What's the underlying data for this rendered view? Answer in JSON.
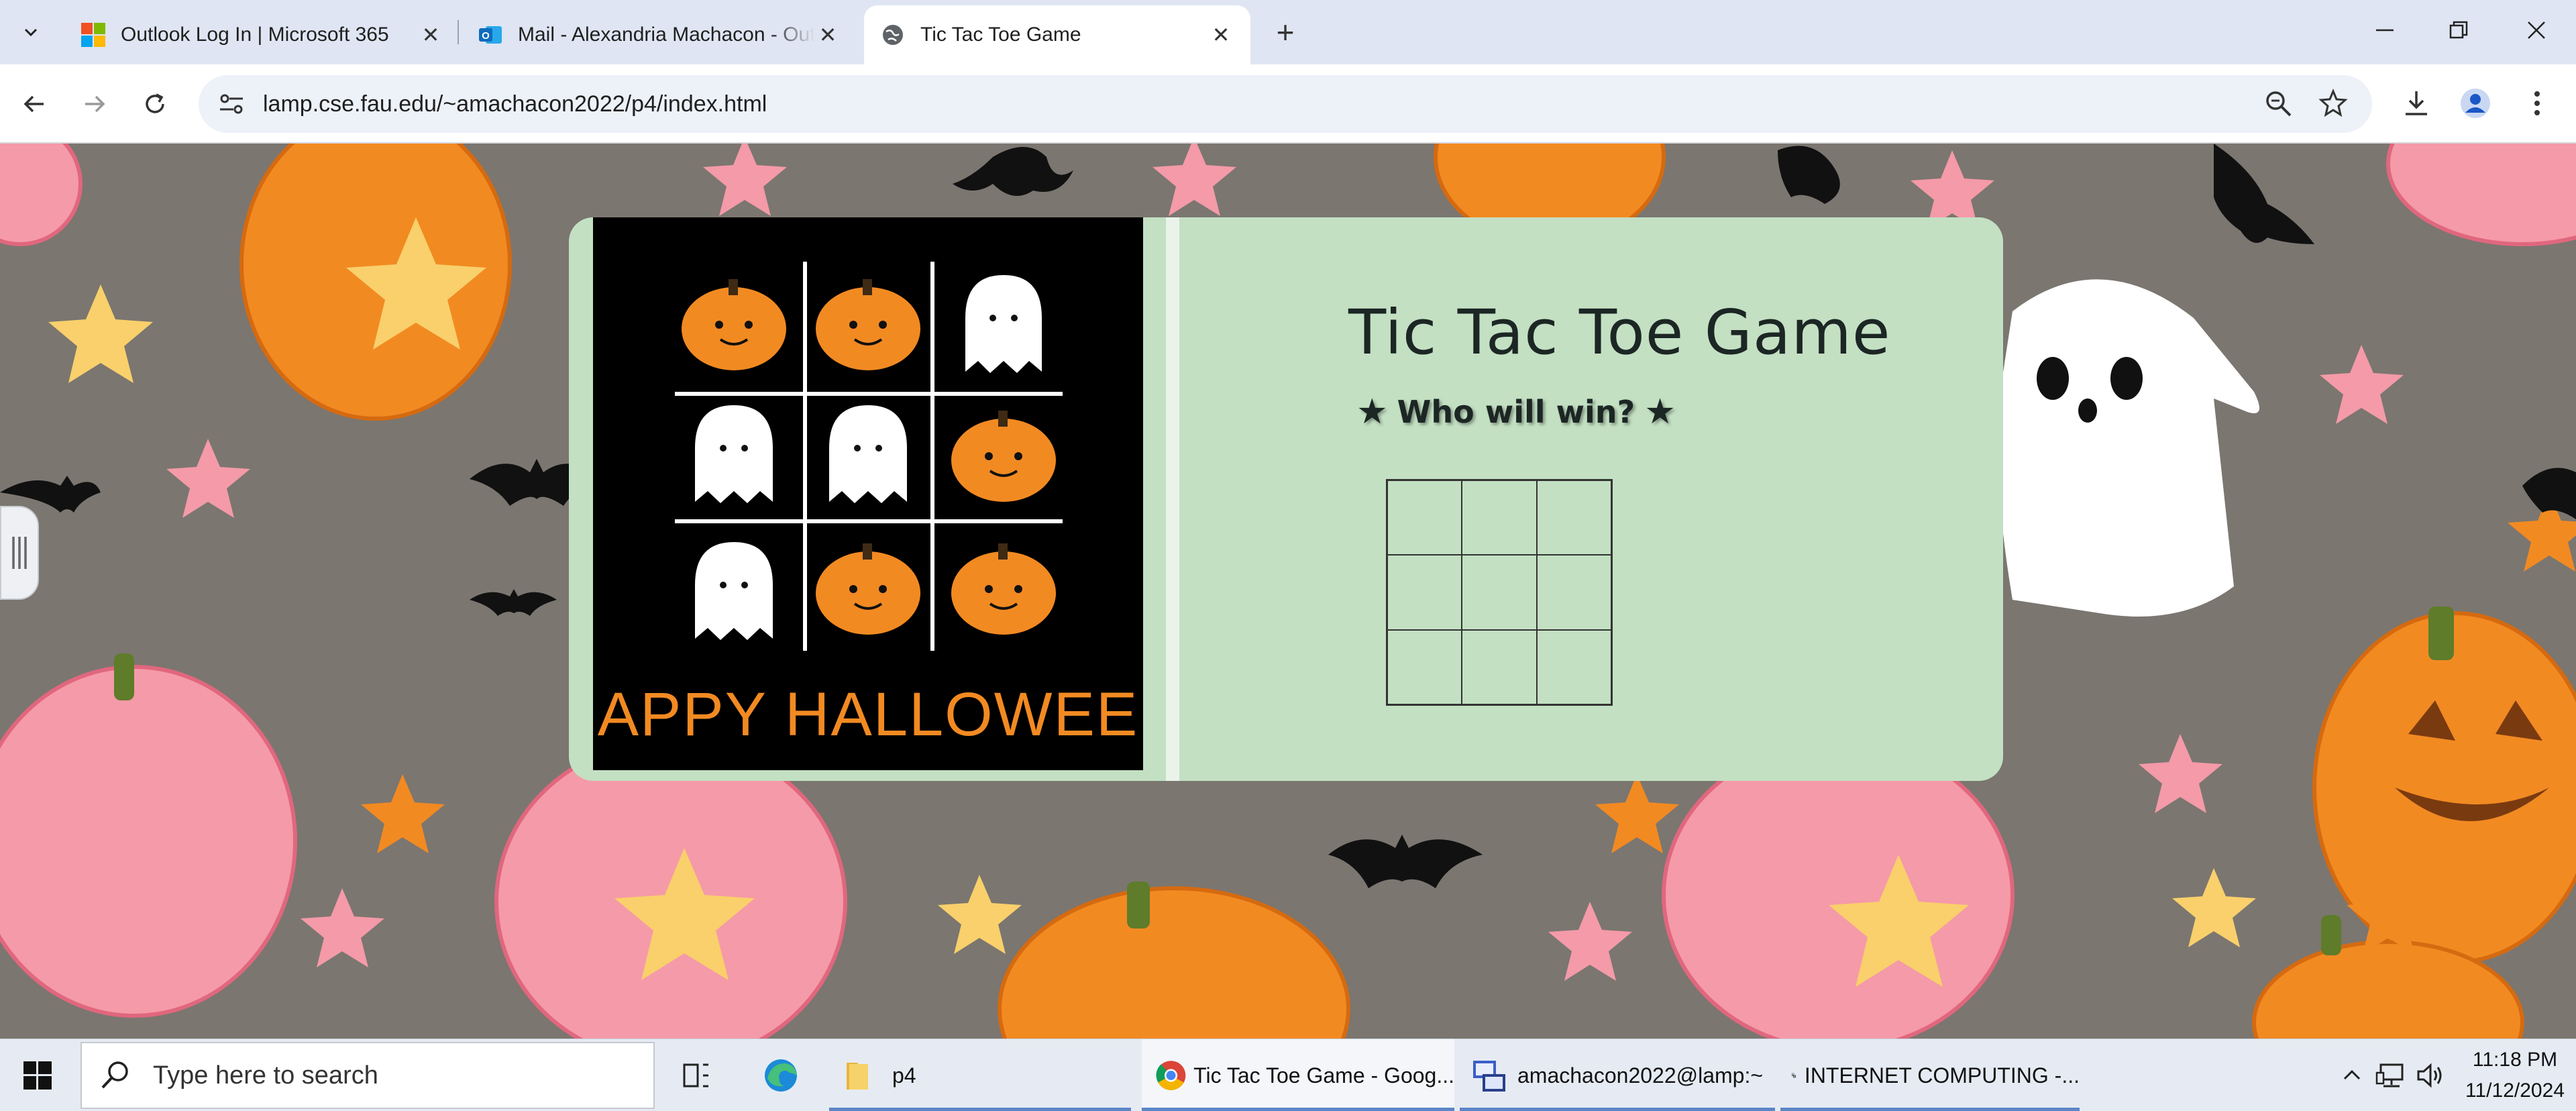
{
  "browser": {
    "tabs": [
      {
        "title": "Outlook Log In | Microsoft 365",
        "icon": "microsoft-logo-icon"
      },
      {
        "title": "Mail - Alexandria Machacon - Outlook",
        "icon": "outlook-icon"
      },
      {
        "title": "Tic Tac Toe Game",
        "icon": "globe-icon"
      }
    ],
    "url": "lamp.cse.fau.edu/~amachacon2022/p4/index.html"
  },
  "page": {
    "image_caption": "HAPPY HALLOWEEN",
    "title": "Tic Tac Toe Game",
    "subtitle": "Who will win?",
    "star_glyph": "★",
    "board_cells": [
      "",
      "",
      "",
      "",
      "",
      "",
      "",
      "",
      ""
    ],
    "card_color": "#c3e0c3"
  },
  "taskbar": {
    "search_placeholder": "Type here to search",
    "items": [
      {
        "label": "p4",
        "icon": "folder-icon"
      },
      {
        "label": "Tic Tac Toe Game - Goog...",
        "icon": "chrome-icon"
      },
      {
        "label": "amachacon2022@lamp:~",
        "icon": "terminal-icon"
      },
      {
        "label": "INTERNET COMPUTING -...",
        "icon": "network-app-icon"
      }
    ],
    "time": "11:18 PM",
    "date": "11/12/2024"
  }
}
